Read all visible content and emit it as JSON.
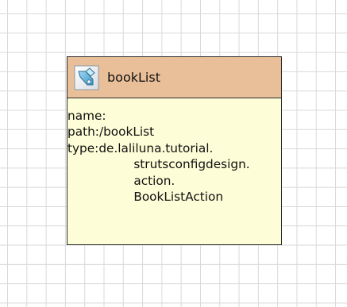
{
  "canvas": {
    "background": "#ffffff",
    "grid_color": "#d9d9d9"
  },
  "action_node": {
    "icon": "action-mapping-icon",
    "title": "bookList",
    "header_color": "#e9bf99",
    "body_color": "#fdfdd7",
    "properties": {
      "name_label": "name:",
      "name_value": "",
      "path_label": "path:",
      "path_value": "/bookList",
      "type_label": "type:",
      "type_lines": [
        "de.laliluna.tutorial.",
        "strutsconfigdesign.",
        "action.",
        "BookListAction"
      ]
    }
  }
}
